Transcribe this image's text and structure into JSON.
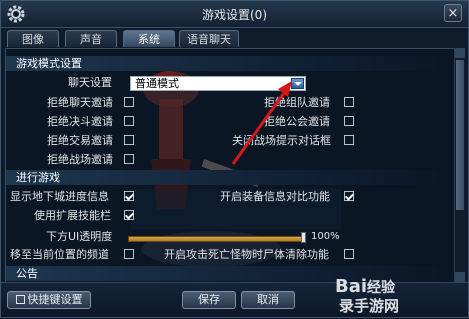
{
  "window": {
    "title": "游戏设置(0)",
    "close_glyph": "×"
  },
  "tabs": [
    {
      "label": "图像",
      "active": false
    },
    {
      "label": "声音",
      "active": false
    },
    {
      "label": "系统",
      "active": true
    },
    {
      "label": "语音聊天",
      "active": false
    }
  ],
  "game_mode": {
    "heading": "游戏模式设置",
    "chat_label": "聊天设置",
    "chat_value": "普通模式",
    "options": [
      {
        "label": "拒绝聊天邀请",
        "checked": false
      },
      {
        "label": "拒绝组队邀请",
        "checked": false
      },
      {
        "label": "拒绝决斗邀请",
        "checked": false
      },
      {
        "label": "拒绝公会邀请",
        "checked": false
      },
      {
        "label": "拒绝交易邀请",
        "checked": false
      },
      {
        "label": "关闭战场提示对话框",
        "checked": false
      },
      {
        "label": "拒绝战场邀请",
        "checked": false
      }
    ]
  },
  "play": {
    "heading": "进行游戏",
    "options": [
      {
        "label": "显示地下城进度信息",
        "checked": true
      },
      {
        "label": "开启装备信息对比功能",
        "checked": true
      },
      {
        "label": "使用扩展技能栏",
        "checked": true
      },
      {
        "label": "移至当前位置的频道",
        "checked": false
      },
      {
        "label": "开启攻击死亡怪物时尸体清除功能",
        "checked": false
      }
    ],
    "ui_opacity_label": "下方UI透明度",
    "ui_opacity_value": "100%",
    "ui_opacity_fraction": 1.0
  },
  "notice": {
    "heading": "公告"
  },
  "footer": {
    "shortcut": "快捷键设置",
    "save": "保存",
    "cancel": "取消"
  },
  "watermark": {
    "text1": "Bai",
    "text2": "经验",
    "text3": "录",
    "text4": "手游网"
  },
  "colors": {
    "accent": "#2b5e9e",
    "annotation": "#d41818"
  }
}
